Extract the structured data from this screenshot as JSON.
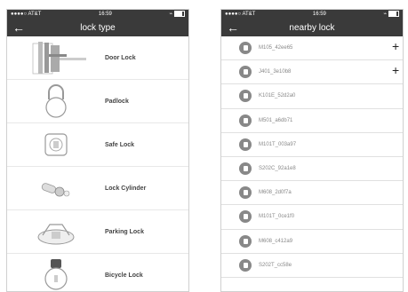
{
  "left_screen": {
    "status": {
      "carrier": "●●●●○ AT&T",
      "time": "16:59"
    },
    "title": "lock type",
    "items": [
      {
        "label": "Door Lock",
        "icon": "door-lock-icon"
      },
      {
        "label": "Padlock",
        "icon": "padlock-icon"
      },
      {
        "label": "Safe Lock",
        "icon": "safe-lock-icon"
      },
      {
        "label": "Lock Cylinder",
        "icon": "lock-cylinder-icon"
      },
      {
        "label": "Parking Lock",
        "icon": "parking-lock-icon"
      },
      {
        "label": "Bicycle Lock",
        "icon": "bicycle-lock-icon"
      }
    ]
  },
  "right_screen": {
    "status": {
      "carrier": "●●●●○ AT&T",
      "time": "16:59"
    },
    "title": "nearby lock",
    "devices": [
      {
        "name": "M105_42ee65",
        "addable": true
      },
      {
        "name": "J401_3e10b8",
        "addable": true
      },
      {
        "name": "K101E_52d2a0",
        "addable": false
      },
      {
        "name": "M501_a6db71",
        "addable": false
      },
      {
        "name": "M101T_003a97",
        "addable": false
      },
      {
        "name": "S202C_92a1e8",
        "addable": false
      },
      {
        "name": "M608_2d0f7a",
        "addable": false
      },
      {
        "name": "M101T_0ce1f0",
        "addable": false
      },
      {
        "name": "M608_c412a9",
        "addable": false
      },
      {
        "name": "S202T_cc58e",
        "addable": false
      }
    ],
    "add_symbol": "+"
  }
}
